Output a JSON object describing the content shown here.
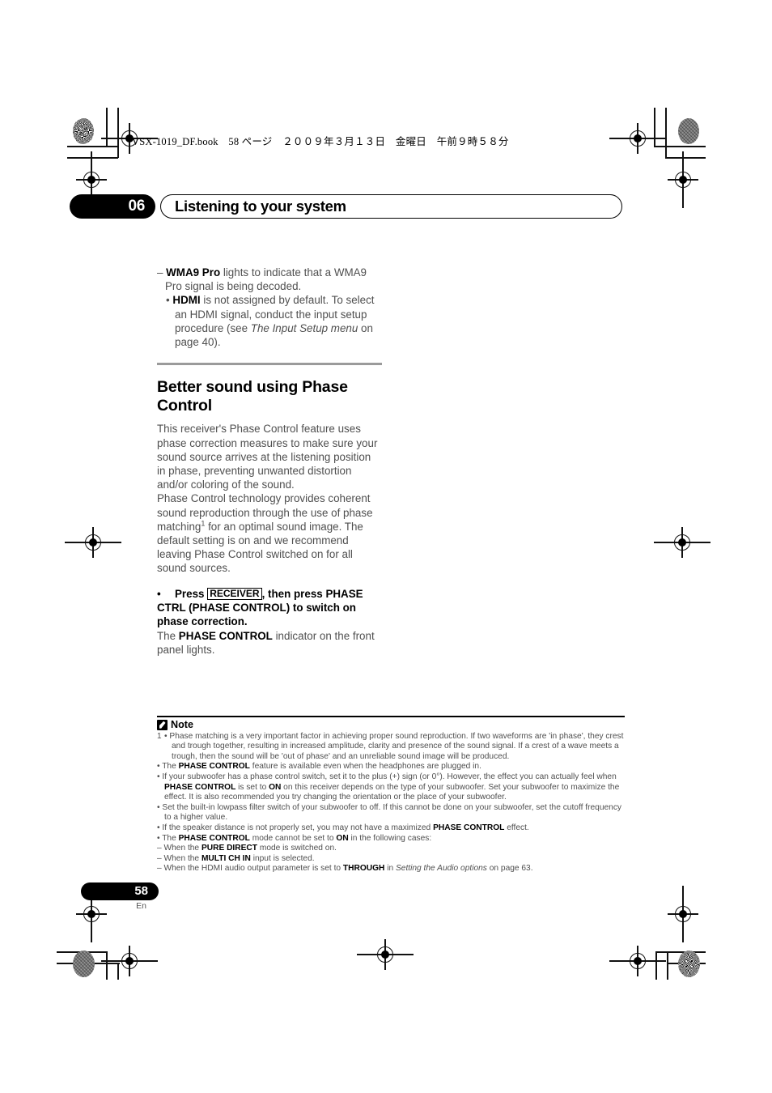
{
  "header": {
    "file_line": "VSX-1019_DF.book　58 ページ　２００９年３月１３日　金曜日　午前９時５８分"
  },
  "chapter": {
    "number": "06",
    "title": "Listening to your system"
  },
  "body": {
    "dash_item_prefix": "– ",
    "dash_item_bold": "WMA9 Pro",
    "dash_item_rest": " lights to indicate that a WMA9 Pro signal is being decoded.",
    "bullet_prefix": "• ",
    "bullet_bold": "HDMI",
    "bullet_text_1": " is not assigned by default. To select an HDMI signal, conduct the input setup procedure (see ",
    "bullet_italic": "The Input Setup menu",
    "bullet_text_2": " on page 40).",
    "section_heading": "Better sound using Phase Control",
    "para_1": "This receiver's Phase Control feature uses phase correction measures to make sure your sound source arrives at the listening position in phase, preventing unwanted distortion and/or coloring of the sound.",
    "para_2_a": "Phase Control technology provides coherent sound reproduction through the use of phase matching",
    "para_2_sup": "1",
    "para_2_b": " for an optimal sound image. The default setting is on and we recommend leaving Phase Control switched on for all sound sources.",
    "action_bullet": "•",
    "action_press": "Press",
    "action_keycap": "RECEIVER",
    "action_rest": ", then press PHASE CTRL (PHASE CONTROL) to switch on phase correction.",
    "after_action_1": "The ",
    "after_action_bold": "PHASE CONTROL",
    "after_action_2": " indicator on the front panel lights."
  },
  "note": {
    "title": "Note",
    "footnote_number": "1",
    "item_1": "• Phase matching is a very important factor in achieving proper sound reproduction. If two waveforms are 'in phase', they crest and trough together, resulting in increased amplitude, clarity and presence of the sound signal. If a crest of a wave meets a trough, then the sound will be 'out of phase' and an unreliable sound image will be produced.",
    "item_2_a": "• The ",
    "item_2_bold": "PHASE CONTROL",
    "item_2_b": " feature is available even when the headphones are plugged in.",
    "item_3_a": "• If your subwoofer has a phase control switch, set it to the plus (+) sign (or 0°). However, the effect you can actually feel when ",
    "item_3_bold1": "PHASE CONTROL",
    "item_3_b": " is set to ",
    "item_3_bold2": "ON",
    "item_3_c": " on this receiver depends on the type of your subwoofer. Set your subwoofer to maximize the effect. It is also recommended you try changing the orientation or the place of your subwoofer.",
    "item_4": "• Set the built-in lowpass filter switch of your subwoofer to off. If this cannot be done on your subwoofer, set the cutoff frequency to a higher value.",
    "item_5_a": "• If the speaker distance is not properly set, you may not have a maximized ",
    "item_5_bold": "PHASE CONTROL",
    "item_5_b": " effect.",
    "item_6_a": "• The ",
    "item_6_bold1": "PHASE CONTROL",
    "item_6_b": " mode cannot be set to ",
    "item_6_bold2": "ON",
    "item_6_c": " in the following cases:",
    "item_7_a": "– When the ",
    "item_7_bold": "PURE DIRECT",
    "item_7_b": " mode is switched on.",
    "item_8_a": "– When the ",
    "item_8_bold": "MULTI CH IN",
    "item_8_b": " input is selected.",
    "item_9_a": "– When the HDMI audio output parameter is set to ",
    "item_9_bold": "THROUGH",
    "item_9_b": " in ",
    "item_9_italic": "Setting the Audio options",
    "item_9_c": " on page 63."
  },
  "footer": {
    "page_number": "58",
    "language": "En"
  },
  "colors": {
    "body_text": "#4f4f4f",
    "heading": "#000000",
    "rule_gray": "#9b9b9b",
    "pill_bg": "#000000"
  }
}
